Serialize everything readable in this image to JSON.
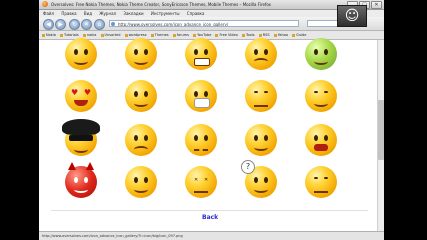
{
  "window": {
    "title": "Oversolves: Free Nokia Themes, Nokia Theme Creator, SonyEricsson Themes, Mobile Themes – Mozilla Firefox"
  },
  "window_buttons": {
    "minimize": "_",
    "maximize": "□",
    "close": "✕"
  },
  "menu": [
    "Файл",
    "Правка",
    "Вид",
    "Журнал",
    "Закладки",
    "Инструменты",
    "Справка"
  ],
  "nav": {
    "url": "http://www.oversolves.com/icon_advance_icon_gallery/",
    "back_glyph": "◀",
    "forward_glyph": "▶",
    "reload_glyph": "↻",
    "stop_glyph": "✕",
    "home_glyph": "⌂"
  },
  "bookmarks": [
    "Nokia",
    "Tutorials",
    "nokia",
    "Unsorted",
    "wordpress",
    "Themes",
    "forums",
    "YouTube",
    "Free Video",
    "Tools",
    "RSS",
    "Yahoo",
    "Guide"
  ],
  "emoji_icons": [
    "grinning-smiley-icon",
    "smiley-with-bandage-icon",
    "big-teeth-smiley-icon",
    "crying-smiley-icon",
    "green-sick-smiley-icon",
    "heart-eyes-smiley-icon",
    "shrugging-smiley-icon",
    "mask-smiley-icon",
    "unamused-smiley-icon",
    "smirking-smiley-icon",
    "afro-sunglasses-smiley-icon",
    "worried-smiley-icon",
    "grimacing-smiley-icon",
    "smiling-smiley-icon",
    "screaming-smiley-icon",
    "devil-smiley-icon",
    "drooling-smiley-icon",
    "dizzy-smiley-icon",
    "confused-question-smiley-icon",
    "sleepy-smiley-icon"
  ],
  "content": {
    "back_link": "Back"
  },
  "status": {
    "text": "http://www.oversolves.com/icon_advance_icon_gallery/?i=icon/big/icon_097.png"
  },
  "colors": {
    "link": "#2a2ad0",
    "emoji_yellow": "#ffd233"
  }
}
